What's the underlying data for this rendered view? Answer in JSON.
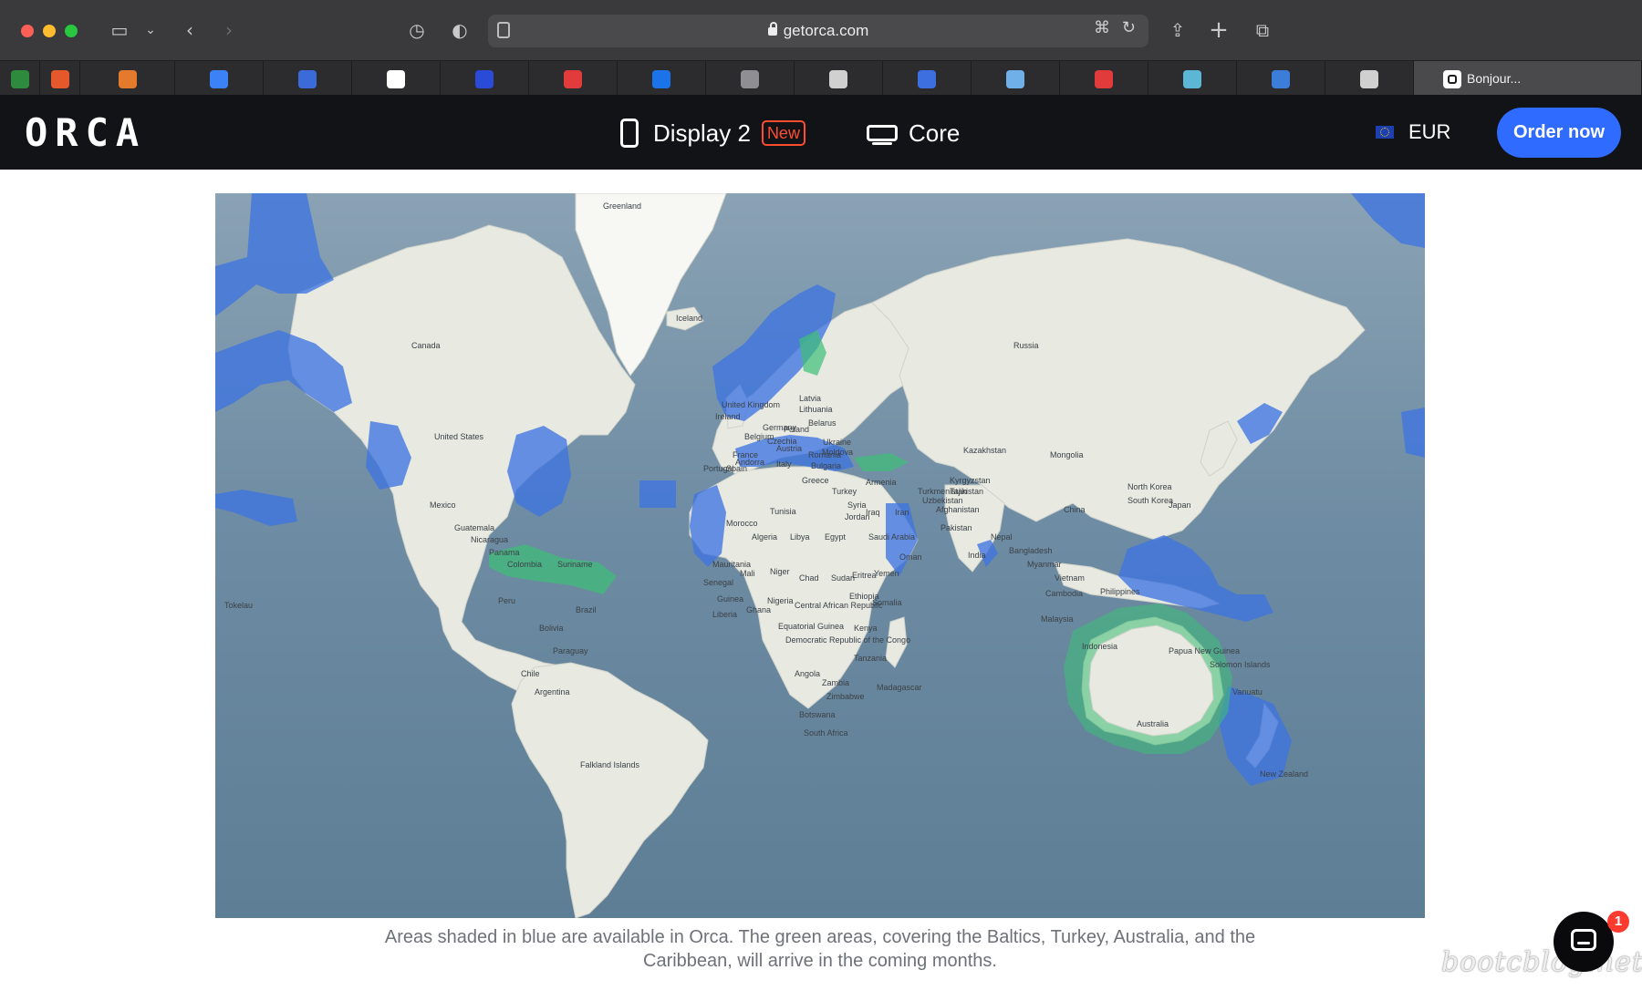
{
  "browser": {
    "url": "getorca.com",
    "active_tab_label": "Bonjour...",
    "tab_favicons": [
      {
        "color": "#2e8b3d"
      },
      {
        "color": "#e4582b"
      },
      {
        "color": "#e37a2c"
      },
      {
        "color": "#3b82f6"
      },
      {
        "color": "#3a6bd8"
      },
      {
        "color": "#ffffff"
      },
      {
        "color": "#2a4bd7"
      },
      {
        "color": "#e23b3b"
      },
      {
        "color": "#1a73e8"
      },
      {
        "color": "#8e8e93"
      },
      {
        "color": "#d0d0d0"
      },
      {
        "color": "#3d6fe0"
      },
      {
        "color": "#6fb0e8"
      },
      {
        "color": "#e23b3b"
      },
      {
        "color": "#5cb7d6"
      },
      {
        "color": "#3b7dd8"
      },
      {
        "color": "#d0d0d0"
      },
      {
        "color": "#c8c8c8"
      }
    ]
  },
  "site": {
    "logo": "ORCA",
    "nav": {
      "display_label": "Display 2",
      "display_badge": "New",
      "core_label": "Core"
    },
    "currency": "EUR",
    "order_label": "Order now"
  },
  "map": {
    "labels": [
      "Greenland",
      "Iceland",
      "Canada",
      "United States",
      "Mexico",
      "Guatemala",
      "Nicaragua",
      "Panama",
      "Colombia",
      "Suriname",
      "Peru",
      "Brazil",
      "Bolivia",
      "Paraguay",
      "Chile",
      "Argentina",
      "Falkland Islands",
      "Tokelau",
      "United Kingdom",
      "Ireland",
      "France",
      "Spain",
      "Portugal",
      "Andorra",
      "Belgium",
      "Germany",
      "Poland",
      "Czechia",
      "Austria",
      "Italy",
      "Lithuania",
      "Latvia",
      "Belarus",
      "Ukraine",
      "Moldova",
      "Romania",
      "Bulgaria",
      "Greece",
      "Turkey",
      "Armenia",
      "Syria",
      "Iraq",
      "Iran",
      "Jordan",
      "Saudi Arabia",
      "Egypt",
      "Libya",
      "Tunisia",
      "Algeria",
      "Morocco",
      "Mauritania",
      "Mali",
      "Niger",
      "Chad",
      "Sudan",
      "Eritrea",
      "Yemen",
      "Oman",
      "Ethiopia",
      "Somalia",
      "Kenya",
      "Nigeria",
      "Ghana",
      "Guinea",
      "Senegal",
      "Liberia",
      "Central African Republic",
      "Democratic Republic of the Congo",
      "Equatorial Guinea",
      "Tanzania",
      "Angola",
      "Zambia",
      "Zimbabwe",
      "Botswana",
      "South Africa",
      "Madagascar",
      "Russia",
      "Kazakhstan",
      "Mongolia",
      "Kyrgyzstan",
      "Tajikistan",
      "Turkmenistan",
      "Uzbekistan",
      "Afghanistan",
      "Pakistan",
      "India",
      "Nepal",
      "Bangladesh",
      "Myanmar",
      "China",
      "Vietnam",
      "Cambodia",
      "Philippines",
      "Malaysia",
      "Indonesia",
      "Papua New Guinea",
      "Solomon Islands",
      "Vanuatu",
      "Australia",
      "New Zealand",
      "North Korea",
      "South Korea",
      "Japan"
    ]
  },
  "caption": {
    "line1": "Areas shaded in blue are available in Orca. The green areas, covering the Baltics, Turkey, Australia, and the",
    "line2": "Caribbean, will arrive in the coming months."
  },
  "chat": {
    "badge_count": "1"
  },
  "watermark": "bootcblog.net"
}
